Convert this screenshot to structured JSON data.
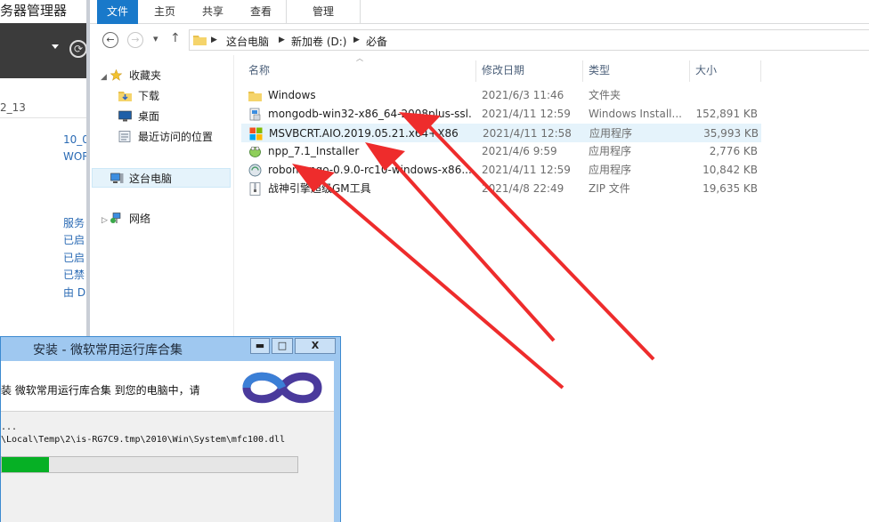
{
  "server_manager": {
    "title": "务器管理器",
    "refresh_glyph": "⟳",
    "version_text": "2_13",
    "links": [
      "10_0",
      "WOR",
      "服务",
      "已启",
      "已启",
      "已禁",
      "由 D"
    ]
  },
  "explorer": {
    "ribbon_tabs": [
      "文件",
      "主页",
      "共享",
      "查看",
      "管理"
    ],
    "nav": {
      "back": "←",
      "forward": "→",
      "recent": "▾",
      "up": "↑"
    },
    "breadcrumb": [
      "这台电脑",
      "新加卷 (D:)",
      "必备"
    ],
    "sidebar": [
      {
        "label": "收藏夹",
        "icon": "star-icon",
        "level": 0,
        "expanded": true
      },
      {
        "label": "下载",
        "icon": "downloads-folder-icon",
        "level": 1
      },
      {
        "label": "桌面",
        "icon": "desktop-icon",
        "level": 1
      },
      {
        "label": "最近访问的位置",
        "icon": "recent-places-icon",
        "level": 1
      },
      {
        "label": "这台电脑",
        "icon": "computer-icon",
        "level": 0,
        "selected": true
      },
      {
        "label": "网络",
        "icon": "network-icon",
        "level": 0
      }
    ],
    "columns": [
      "名称",
      "修改日期",
      "类型",
      "大小"
    ],
    "files": [
      {
        "name": "Windows",
        "date": "2021/6/3 11:46",
        "type": "文件夹",
        "size": "",
        "icon": "folder-icon"
      },
      {
        "name": "mongodb-win32-x86_64-2008plus-ssl...",
        "date": "2021/4/11 12:59",
        "type": "Windows Install...",
        "size": "152,891 KB",
        "icon": "msi-installer-icon"
      },
      {
        "name": "MSVBCRT.AIO.2019.05.21.x64+X86",
        "date": "2021/4/11 12:58",
        "type": "应用程序",
        "size": "35,993 KB",
        "icon": "windows-logo-icon"
      },
      {
        "name": "npp_7.1_Installer",
        "date": "2021/4/6 9:59",
        "type": "应用程序",
        "size": "2,776 KB",
        "icon": "notepad-plus-icon"
      },
      {
        "name": "robomongo-0.9.0-rc10-windows-x86...",
        "date": "2021/4/11 12:59",
        "type": "应用程序",
        "size": "10,842 KB",
        "icon": "robomongo-icon"
      },
      {
        "name": "战神引擎超级GM工具",
        "date": "2021/4/8 22:49",
        "type": "ZIP 文件",
        "size": "19,635 KB",
        "icon": "zip-file-icon"
      }
    ],
    "hover_row": 2
  },
  "installer": {
    "title": "安装 - 微软常用运行库合集",
    "buttons": {
      "minimize": "▬",
      "maximize": "□",
      "close": "X"
    },
    "description": "装 微软常用运行库合集 到您的电脑中，请",
    "status": "...",
    "path": "\\Local\\Temp\\2\\is-RG7C9.tmp\\2010\\Win\\System\\mfc100.dll",
    "progress": 0.16
  },
  "colors": {
    "accent": "#1979ca",
    "annotation_arrow": "#ee2c2c",
    "progress": "#06b025"
  }
}
